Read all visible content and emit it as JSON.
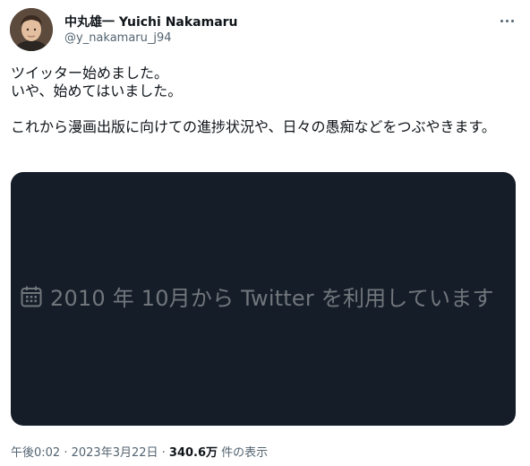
{
  "author": {
    "display_name": "中丸雄一 Yuichi Nakamaru",
    "handle": "@y_nakamaru_j94"
  },
  "tweet": {
    "lines": [
      "ツイッター始めました。",
      "いや、始めてはいました。",
      "",
      "これから漫画出版に向けての進捗状況や、日々の愚痴などをつぶやきます。"
    ]
  },
  "media": {
    "icon": "calendar-icon",
    "caption": "2010 年 10月から Twitter を利用しています",
    "background": "#151d29",
    "text_color": "#71767b"
  },
  "meta": {
    "time": "午後0:02",
    "separator1": " · ",
    "date": "2023年3月22日",
    "separator2": " · ",
    "views_count": "340.6万",
    "views_suffix": " 件の表示"
  },
  "colors": {
    "primary_text": "#0f1419",
    "secondary_text": "#536471"
  }
}
